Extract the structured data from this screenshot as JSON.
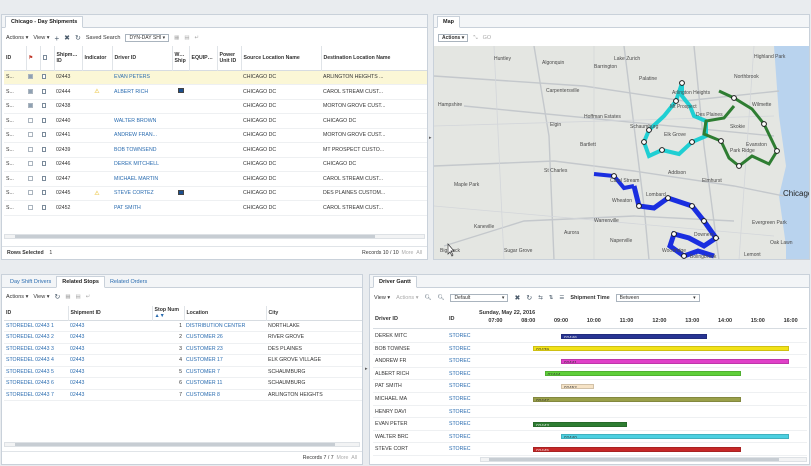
{
  "shipments_panel": {
    "tab": "Chicago - Day Shipments",
    "toolbar": {
      "actions": "Actions",
      "view": "View",
      "saved_search_label": "Saved Search",
      "saved_search_value": "DYN-DAY SHI"
    },
    "columns": [
      "ID",
      "",
      "",
      "Shipment ID",
      "Indicator",
      "Driver ID",
      "Watch Ship",
      "EQUIPME",
      "Power Unit ID",
      "Source Location Name",
      "Destination Location Name"
    ],
    "rows": [
      {
        "id": "S...",
        "checked": true,
        "shipment_id": "02443",
        "indicator": "",
        "driver": "EVAN PETERS",
        "watch": false,
        "source": "CHICAGO DC",
        "dest": "ARLINGTON HEIGHTS ..."
      },
      {
        "id": "S...",
        "checked": true,
        "shipment_id": "02444",
        "indicator": "⚠",
        "driver": "ALBERT RICH",
        "watch": true,
        "source": "CHICAGO DC",
        "dest": "CAROL STREAM CUST..."
      },
      {
        "id": "S...",
        "checked": true,
        "shipment_id": "02438",
        "indicator": "",
        "driver": "",
        "watch": false,
        "source": "CHICAGO DC",
        "dest": "MORTON GROVE CUST..."
      },
      {
        "id": "S...",
        "checked": false,
        "shipment_id": "02440",
        "indicator": "",
        "driver": "WALTER BROWN",
        "watch": false,
        "source": "CHICAGO DC",
        "dest": "CHICAGO DC"
      },
      {
        "id": "S...",
        "checked": false,
        "shipment_id": "02441",
        "indicator": "",
        "driver": "ANDREW FRAN...",
        "watch": false,
        "source": "CHICAGO DC",
        "dest": "MORTON GROVE CUST..."
      },
      {
        "id": "S...",
        "checked": false,
        "shipment_id": "02439",
        "indicator": "",
        "driver": "BOB TOWNSEND",
        "watch": false,
        "source": "CHICAGO DC",
        "dest": "MT PROSPECT CUSTO..."
      },
      {
        "id": "S...",
        "checked": false,
        "shipment_id": "02446",
        "indicator": "",
        "driver": "DEREK MITCHELL",
        "watch": false,
        "source": "CHICAGO DC",
        "dest": "CHICAGO DC"
      },
      {
        "id": "S...",
        "checked": false,
        "shipment_id": "02447",
        "indicator": "",
        "driver": "MICHAEL MARTIN",
        "watch": false,
        "source": "CHICAGO DC",
        "dest": "CAROL STREAM CUST..."
      },
      {
        "id": "S...",
        "checked": false,
        "shipment_id": "02445",
        "indicator": "⚠",
        "driver": "STEVE CORTEZ",
        "watch": true,
        "source": "CHICAGO DC",
        "dest": "DES PLAINES CUSTOM..."
      },
      {
        "id": "S...",
        "checked": false,
        "shipment_id": "02452",
        "indicator": "",
        "driver": "PAT SMITH",
        "watch": false,
        "source": "CHICAGO DC",
        "dest": "CAROL STREAM CUST..."
      }
    ],
    "footer_left": "Rows Selected",
    "footer_count": "1",
    "footer_right": "Records 10 / 10",
    "more": "More",
    "all": "All"
  },
  "map_panel": {
    "tab": "Map",
    "toolbar": {
      "actions": "Actions",
      "go": "GO"
    },
    "labels": [
      "Huntley",
      "Algonquin",
      "Barrington",
      "Palatine",
      "Arlington Heights",
      "Mt Prospect",
      "Des Plaines",
      "Northbrook",
      "Highland Park",
      "Wilmette",
      "Evanston",
      "Skokie",
      "Carpentersville",
      "Elgin",
      "Hoffman Estates",
      "Schaumburg",
      "Bartlett",
      "Elk Grove",
      "Addison",
      "Elmhurst",
      "St Charles",
      "Carol Stream",
      "Lombard",
      "Wheaton",
      "Maple Park",
      "Aurora",
      "Naperville",
      "Woodridge",
      "Downers",
      "Bolingbrook",
      "Chicago",
      "Lemont",
      "Hampshire",
      "Lake Zurich",
      "Park Ridge",
      "Oak Lawn",
      "Evergreen Park",
      "Warrenville",
      "Big Rock",
      "Sugar Grove",
      "Kaneville"
    ]
  },
  "stops_panel": {
    "tabs": [
      "Day Shift Drivers",
      "Related Stops",
      "Related Orders"
    ],
    "active_tab": "Related Stops",
    "toolbar": {
      "actions": "Actions",
      "view": "View"
    },
    "columns": [
      "ID",
      "Shipment ID",
      "Stop Num",
      "Location",
      "City"
    ],
    "rows": [
      {
        "id": "STOREDEL 02443 1",
        "shipment": "02443",
        "stop": "1",
        "location": "DISTRIBUTION CENTER",
        "city": "NORTHLAKE"
      },
      {
        "id": "STOREDEL 02443 2",
        "shipment": "02443",
        "stop": "2",
        "location": "CUSTOMER 26",
        "city": "RIVER GROVE"
      },
      {
        "id": "STOREDEL 02443 3",
        "shipment": "02443",
        "stop": "3",
        "location": "CUSTOMER 23",
        "city": "DES PLAINES"
      },
      {
        "id": "STOREDEL 02443 4",
        "shipment": "02443",
        "stop": "4",
        "location": "CUSTOMER 17",
        "city": "ELK GROVE VILLAGE"
      },
      {
        "id": "STOREDEL 02443 5",
        "shipment": "02443",
        "stop": "5",
        "location": "CUSTOMER 7",
        "city": "SCHAUMBURG"
      },
      {
        "id": "STOREDEL 02443 6",
        "shipment": "02443",
        "stop": "6",
        "location": "CUSTOMER 11",
        "city": "SCHAUMBURG"
      },
      {
        "id": "STOREDEL 02443 7",
        "shipment": "02443",
        "stop": "7",
        "location": "CUSTOMER 8",
        "city": "ARLINGTON HEIGHTS"
      }
    ],
    "footer_right": "Records 7 / 7",
    "more": "More",
    "all": "All"
  },
  "gantt_panel": {
    "tab": "Driver Gantt",
    "toolbar": {
      "view": "View",
      "actions": "Actions",
      "default": "Default",
      "shipment_time_label": "Shipment Time",
      "shipment_time_value": "Between"
    },
    "columns": [
      "Driver ID",
      "ID"
    ],
    "date": "Sunday, May 22, 2016",
    "hours": [
      "07:00",
      "08:00",
      "09:00",
      "10:00",
      "11:00",
      "12:00",
      "13:00",
      "14:00",
      "15:00",
      "16:00"
    ],
    "rows": [
      {
        "driver": "DEREK MITC",
        "id": "STOREC",
        "bar_label": "02446",
        "start": 9.0,
        "end": 13.45,
        "color": "#283593"
      },
      {
        "driver": "BOB TOWNSE",
        "id": "STOREC",
        "bar_label": "02439",
        "start": 8.15,
        "end": 15.95,
        "color": "#f2e218"
      },
      {
        "driver": "ANDREW FR",
        "id": "STOREC",
        "bar_label": "02441",
        "start": 9.0,
        "end": 15.95,
        "color": "#e040c8"
      },
      {
        "driver": "ALBERT RICH",
        "id": "STOREC",
        "bar_label": "02444",
        "start": 8.5,
        "end": 14.5,
        "color": "#5fcf3a"
      },
      {
        "driver": "PAT SMITH",
        "id": "STOREC",
        "bar_label": "02452",
        "start": 9.0,
        "end": 10.0,
        "color": "#f6e3c6"
      },
      {
        "driver": "MICHAEL MA",
        "id": "STOREC",
        "bar_label": "02447",
        "start": 8.15,
        "end": 14.5,
        "color": "#9aa04a"
      },
      {
        "driver": "HENRY DAVI",
        "id": "STOREC",
        "bar_label": "",
        "start": 0,
        "end": 0,
        "color": "#ffffff"
      },
      {
        "driver": "EVAN PETER",
        "id": "STOREC",
        "bar_label": "02443",
        "start": 8.15,
        "end": 11.0,
        "color": "#2e7d32"
      },
      {
        "driver": "WALTER BRC",
        "id": "STOREC",
        "bar_label": "02440",
        "start": 9.0,
        "end": 15.95,
        "color": "#4dd0e1"
      },
      {
        "driver": "STEVE CORT",
        "id": "STOREC",
        "bar_label": "02445",
        "start": 8.15,
        "end": 14.5,
        "color": "#c62828"
      }
    ]
  }
}
